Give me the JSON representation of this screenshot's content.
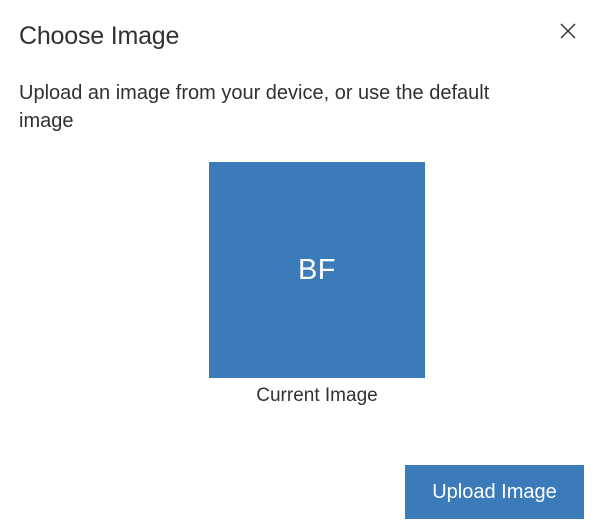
{
  "dialog": {
    "title": "Choose Image",
    "close_icon": "close-icon",
    "description": "Upload an image from your device, or use the default image",
    "avatar": {
      "initials": "BF",
      "background_color": "#3b7bba"
    },
    "caption": "Current Image",
    "upload_button_label": "Upload Image",
    "accent_color": "#3b7bba"
  }
}
